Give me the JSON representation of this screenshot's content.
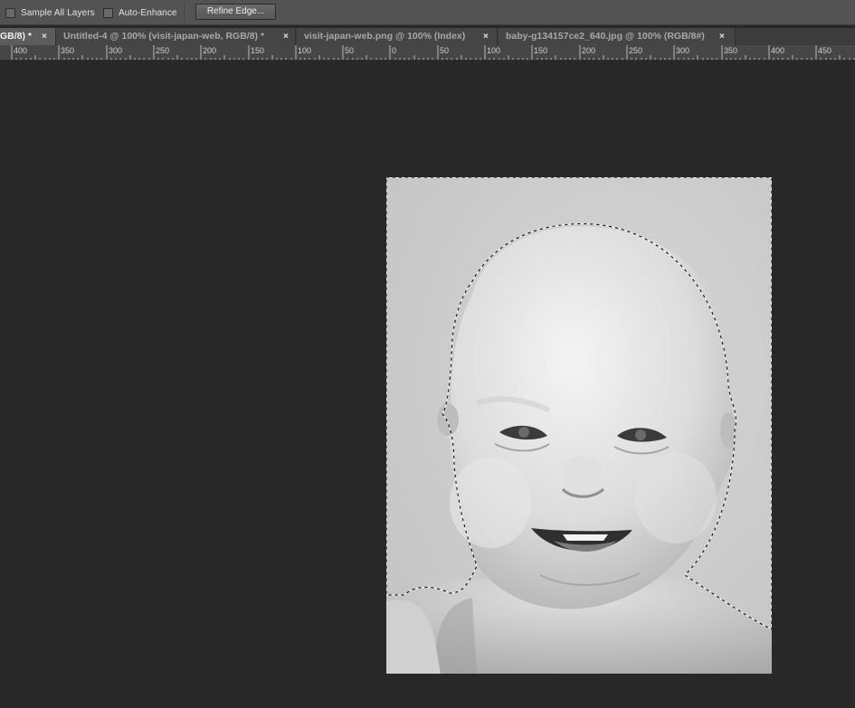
{
  "options_bar": {
    "sample_all_layers_label": "Sample All Layers",
    "auto_enhance_label": "Auto-Enhance",
    "refine_edge_label": "Refine Edge..."
  },
  "tabs": [
    {
      "label": "GB/8) *",
      "active": true
    },
    {
      "label": "Untitled-4 @ 100% (visit-japan-web, RGB/8) *",
      "active": false
    },
    {
      "label": "visit-japan-web.png @ 100% (Index)",
      "active": false
    },
    {
      "label": "baby-g134157ce2_640.jpg @ 100% (RGB/8#)",
      "active": false
    }
  ],
  "tab_close_glyph": "×",
  "ruler": {
    "labels": [
      "400",
      "350",
      "300",
      "250",
      "200",
      "150",
      "100",
      "50",
      "0",
      "50",
      "100",
      "150",
      "200",
      "250",
      "300",
      "350",
      "400",
      "450"
    ]
  },
  "canvas": {
    "image_name": "baby-photo",
    "selection": "marching-ants"
  }
}
